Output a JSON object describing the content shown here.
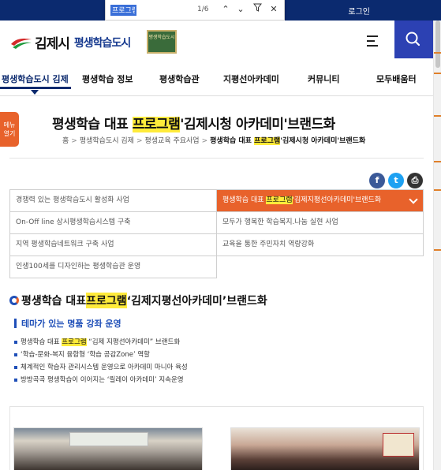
{
  "browser": {
    "find_query": "프로그램",
    "find_count": "1/6"
  },
  "topbar": {
    "login": "로그인"
  },
  "header": {
    "logo_city": "김제시",
    "logo_sub": "평생학습도시",
    "badge_text": "평생학습도시",
    "menu_icon": "hamburger-icon",
    "search_icon": "search-icon"
  },
  "nav": {
    "items": [
      {
        "label": "평생학습도시 김제"
      },
      {
        "label": "평생학습 정보"
      },
      {
        "label": "평생학습관"
      },
      {
        "label": "지평선아카데미"
      },
      {
        "label": "커뮤니티"
      },
      {
        "label": "모두배움터"
      }
    ]
  },
  "side_menu": {
    "line1": "메뉴",
    "line2": "열기"
  },
  "page": {
    "title_pre": "평생학습 대표 ",
    "title_hl": "프로그램",
    "title_post": "'김제시청 아카데미'브랜드화",
    "breadcrumb": {
      "home": "홈",
      "b1": "평생학습도시 김제",
      "b2": "평생교육 주요사업",
      "cur_pre": "평생학습 대표 ",
      "cur_hl": "프로그램",
      "cur_post": "'김제시청 아카데미'브랜드화"
    }
  },
  "share": {
    "facebook": "f",
    "twitter": "t",
    "print": "⎙"
  },
  "submenu": {
    "rows": [
      [
        "경쟁력 있는 평생학습도시 활성화 사업",
        "평생학습 대표 프로그램'김제지평선아카데미'브랜드화"
      ],
      [
        "On-Off line 상시평생학습시스템 구축",
        "모두가 행복한 학습복지.나눔 실현 사업"
      ],
      [
        "지역 평생학습네트워크 구축 사업",
        "교육을 통한 주민자치 역량강화"
      ],
      [
        "인생100세를 디자인하는 평생학습관 운영",
        ""
      ]
    ],
    "active_pre": "평생학습 대표 ",
    "active_hl": "프로그램",
    "active_post": "'김제지평선아카데미'브랜드화"
  },
  "content": {
    "section_pre": "평생학습 대표 ",
    "section_hl": "프로그램",
    "section_post": "‘김제지평선아카데미’브랜드화",
    "sub_title": "테마가 있는 명품 강좌 운영",
    "bullets": {
      "b1_pre": "평생학습 대표 ",
      "b1_hl": "프로그램",
      "b1_post": " “김제 지평선아카데미” 브랜드화",
      "b2": "‘학습-문화-복지 융합형 ‘학습 공감Zone’ 역할",
      "b3": "체계적인 학습자 관리시스템 운영으로 아카데미 마니아 육성",
      "b4": "방방곡곡 평생학습이 이어지는 ‘릴레이 아카데미’ 지속운영"
    }
  },
  "colors": {
    "nav_blue": "#0b2a6f",
    "accent_orange": "#e8622b",
    "search_blue": "#2c41b3",
    "highlight": "#ffeb3b"
  }
}
